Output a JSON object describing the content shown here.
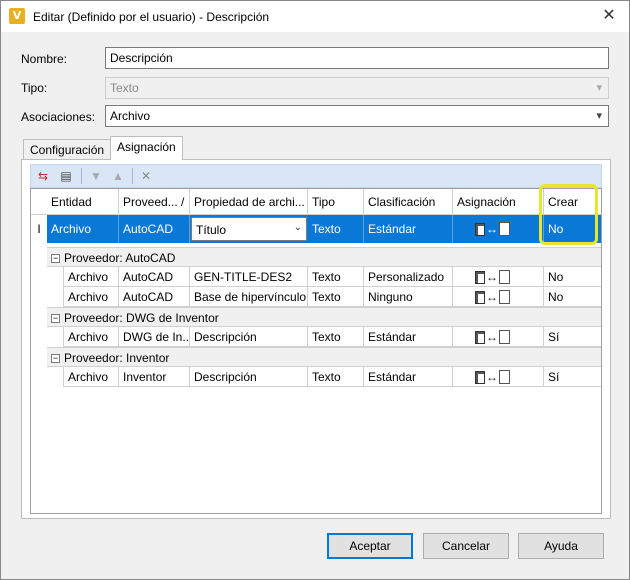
{
  "window": {
    "title": "Editar (Definido por el usuario) - Descripción",
    "app_icon_letter": "V",
    "close_glyph": "✕"
  },
  "form": {
    "nombre": {
      "label": "Nombre:",
      "value": "Descripción"
    },
    "tipo": {
      "label": "Tipo:",
      "value": "Texto"
    },
    "asociaciones": {
      "label": "Asociaciones:",
      "value": "Archivo"
    }
  },
  "tabs": [
    {
      "label": "Configuración"
    },
    {
      "label": "Asignación"
    }
  ],
  "toolbar": {
    "icons": [
      "add-mapping-icon",
      "properties-icon",
      "move-down-icon",
      "move-up-icon",
      "delete-icon"
    ]
  },
  "grid": {
    "headers": [
      "Entidad",
      "Proveed... /",
      "Propiedad de archi...",
      "Tipo",
      "Clasificación",
      "Asignación",
      "Crear"
    ],
    "selected_row": {
      "indicator": "I",
      "entidad": "Archivo",
      "proveedor": "AutoCAD",
      "propiedad": "Título",
      "tipo": "Texto",
      "clasificacion": "Estándar",
      "crear": "No"
    },
    "groups": [
      {
        "title": "Proveedor: AutoCAD",
        "rows": [
          {
            "entidad": "Archivo",
            "proveedor": "AutoCAD",
            "propiedad": "GEN-TITLE-DES2",
            "tipo": "Texto",
            "clasificacion": "Personalizado",
            "crear": "No"
          },
          {
            "entidad": "Archivo",
            "proveedor": "AutoCAD",
            "propiedad": "Base de hipervínculo",
            "tipo": "Texto",
            "clasificacion": "Ninguno",
            "crear": "No"
          }
        ]
      },
      {
        "title": "Proveedor: DWG de Inventor",
        "rows": [
          {
            "entidad": "Archivo",
            "proveedor": "DWG de In...",
            "propiedad": "Descripción",
            "tipo": "Texto",
            "clasificacion": "Estándar",
            "crear": "Sí"
          }
        ]
      },
      {
        "title": "Proveedor: Inventor",
        "rows": [
          {
            "entidad": "Archivo",
            "proveedor": "Inventor",
            "propiedad": "Descripción",
            "tipo": "Texto",
            "clasificacion": "Estándar",
            "crear": "Sí"
          }
        ]
      }
    ]
  },
  "buttons": {
    "accept": "Aceptar",
    "cancel": "Cancelar",
    "help": "Ayuda"
  },
  "colors": {
    "selection": "#0a78d7",
    "highlight": "#e6e62c",
    "toolbar": "#d9e6f5"
  }
}
